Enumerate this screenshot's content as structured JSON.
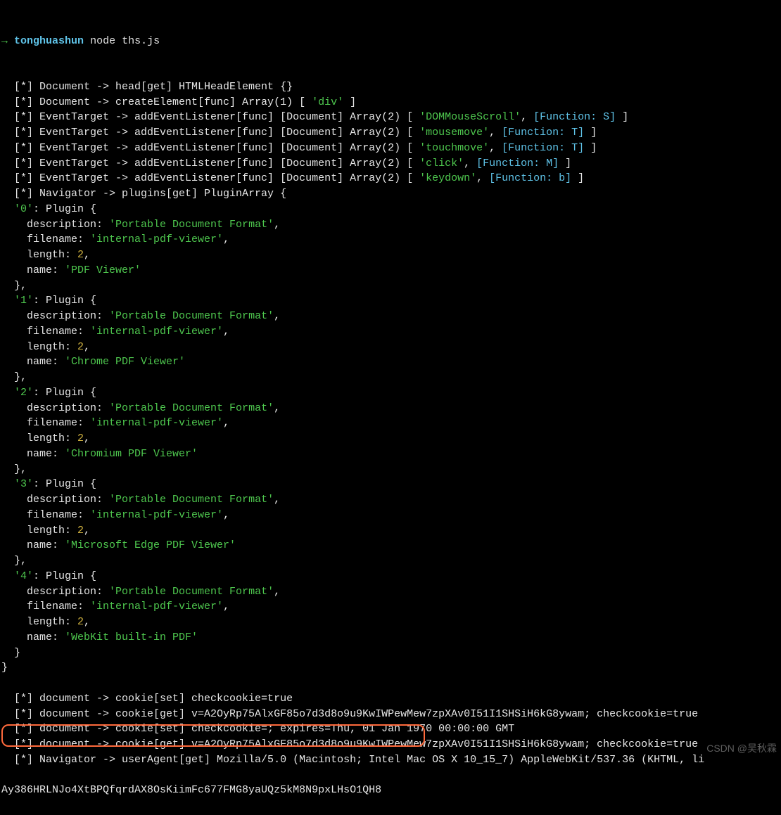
{
  "prompt": {
    "arrow": "→",
    "dir": "tonghuashun",
    "cmd": "node ths.js"
  },
  "lines": [
    [
      {
        "c": "white",
        "t": "  [*] Document -> head[get] HTMLHeadElement {}"
      }
    ],
    [
      {
        "c": "white",
        "t": "  [*] Document -> createElement[func] Array(1) [ "
      },
      {
        "c": "str",
        "t": "'div'"
      },
      {
        "c": "white",
        "t": " ]"
      }
    ],
    [
      {
        "c": "white",
        "t": "  [*] EventTarget -> addEventListener[func] [Document] Array(2) [ "
      },
      {
        "c": "str",
        "t": "'DOMMouseScroll'"
      },
      {
        "c": "white",
        "t": ", "
      },
      {
        "c": "cyan",
        "t": "[Function: S]"
      },
      {
        "c": "white",
        "t": " ]"
      }
    ],
    [
      {
        "c": "white",
        "t": "  [*] EventTarget -> addEventListener[func] [Document] Array(2) [ "
      },
      {
        "c": "str",
        "t": "'mousemove'"
      },
      {
        "c": "white",
        "t": ", "
      },
      {
        "c": "cyan",
        "t": "[Function: T]"
      },
      {
        "c": "white",
        "t": " ]"
      }
    ],
    [
      {
        "c": "white",
        "t": "  [*] EventTarget -> addEventListener[func] [Document] Array(2) [ "
      },
      {
        "c": "str",
        "t": "'touchmove'"
      },
      {
        "c": "white",
        "t": ", "
      },
      {
        "c": "cyan",
        "t": "[Function: T]"
      },
      {
        "c": "white",
        "t": " ]"
      }
    ],
    [
      {
        "c": "white",
        "t": "  [*] EventTarget -> addEventListener[func] [Document] Array(2) [ "
      },
      {
        "c": "str",
        "t": "'click'"
      },
      {
        "c": "white",
        "t": ", "
      },
      {
        "c": "cyan",
        "t": "[Function: M]"
      },
      {
        "c": "white",
        "t": " ]"
      }
    ],
    [
      {
        "c": "white",
        "t": "  [*] EventTarget -> addEventListener[func] [Document] Array(2) [ "
      },
      {
        "c": "str",
        "t": "'keydown'"
      },
      {
        "c": "white",
        "t": ", "
      },
      {
        "c": "cyan",
        "t": "[Function: b]"
      },
      {
        "c": "white",
        "t": " ]"
      }
    ],
    [
      {
        "c": "white",
        "t": "  [*] Navigator -> plugins[get] PluginArray {"
      }
    ],
    [
      {
        "c": "white",
        "t": "  "
      },
      {
        "c": "str",
        "t": "'0'"
      },
      {
        "c": "white",
        "t": ": Plugin {"
      }
    ],
    [
      {
        "c": "white",
        "t": "    description: "
      },
      {
        "c": "str",
        "t": "'Portable Document Format'"
      },
      {
        "c": "white",
        "t": ","
      }
    ],
    [
      {
        "c": "white",
        "t": "    filename: "
      },
      {
        "c": "str",
        "t": "'internal-pdf-viewer'"
      },
      {
        "c": "white",
        "t": ","
      }
    ],
    [
      {
        "c": "white",
        "t": "    length: "
      },
      {
        "c": "num",
        "t": "2"
      },
      {
        "c": "white",
        "t": ","
      }
    ],
    [
      {
        "c": "white",
        "t": "    name: "
      },
      {
        "c": "str",
        "t": "'PDF Viewer'"
      }
    ],
    [
      {
        "c": "white",
        "t": "  },"
      }
    ],
    [
      {
        "c": "white",
        "t": "  "
      },
      {
        "c": "str",
        "t": "'1'"
      },
      {
        "c": "white",
        "t": ": Plugin {"
      }
    ],
    [
      {
        "c": "white",
        "t": "    description: "
      },
      {
        "c": "str",
        "t": "'Portable Document Format'"
      },
      {
        "c": "white",
        "t": ","
      }
    ],
    [
      {
        "c": "white",
        "t": "    filename: "
      },
      {
        "c": "str",
        "t": "'internal-pdf-viewer'"
      },
      {
        "c": "white",
        "t": ","
      }
    ],
    [
      {
        "c": "white",
        "t": "    length: "
      },
      {
        "c": "num",
        "t": "2"
      },
      {
        "c": "white",
        "t": ","
      }
    ],
    [
      {
        "c": "white",
        "t": "    name: "
      },
      {
        "c": "str",
        "t": "'Chrome PDF Viewer'"
      }
    ],
    [
      {
        "c": "white",
        "t": "  },"
      }
    ],
    [
      {
        "c": "white",
        "t": "  "
      },
      {
        "c": "str",
        "t": "'2'"
      },
      {
        "c": "white",
        "t": ": Plugin {"
      }
    ],
    [
      {
        "c": "white",
        "t": "    description: "
      },
      {
        "c": "str",
        "t": "'Portable Document Format'"
      },
      {
        "c": "white",
        "t": ","
      }
    ],
    [
      {
        "c": "white",
        "t": "    filename: "
      },
      {
        "c": "str",
        "t": "'internal-pdf-viewer'"
      },
      {
        "c": "white",
        "t": ","
      }
    ],
    [
      {
        "c": "white",
        "t": "    length: "
      },
      {
        "c": "num",
        "t": "2"
      },
      {
        "c": "white",
        "t": ","
      }
    ],
    [
      {
        "c": "white",
        "t": "    name: "
      },
      {
        "c": "str",
        "t": "'Chromium PDF Viewer'"
      }
    ],
    [
      {
        "c": "white",
        "t": "  },"
      }
    ],
    [
      {
        "c": "white",
        "t": "  "
      },
      {
        "c": "str",
        "t": "'3'"
      },
      {
        "c": "white",
        "t": ": Plugin {"
      }
    ],
    [
      {
        "c": "white",
        "t": "    description: "
      },
      {
        "c": "str",
        "t": "'Portable Document Format'"
      },
      {
        "c": "white",
        "t": ","
      }
    ],
    [
      {
        "c": "white",
        "t": "    filename: "
      },
      {
        "c": "str",
        "t": "'internal-pdf-viewer'"
      },
      {
        "c": "white",
        "t": ","
      }
    ],
    [
      {
        "c": "white",
        "t": "    length: "
      },
      {
        "c": "num",
        "t": "2"
      },
      {
        "c": "white",
        "t": ","
      }
    ],
    [
      {
        "c": "white",
        "t": "    name: "
      },
      {
        "c": "str",
        "t": "'Microsoft Edge PDF Viewer'"
      }
    ],
    [
      {
        "c": "white",
        "t": "  },"
      }
    ],
    [
      {
        "c": "white",
        "t": "  "
      },
      {
        "c": "str",
        "t": "'4'"
      },
      {
        "c": "white",
        "t": ": Plugin {"
      }
    ],
    [
      {
        "c": "white",
        "t": "    description: "
      },
      {
        "c": "str",
        "t": "'Portable Document Format'"
      },
      {
        "c": "white",
        "t": ","
      }
    ],
    [
      {
        "c": "white",
        "t": "    filename: "
      },
      {
        "c": "str",
        "t": "'internal-pdf-viewer'"
      },
      {
        "c": "white",
        "t": ","
      }
    ],
    [
      {
        "c": "white",
        "t": "    length: "
      },
      {
        "c": "num",
        "t": "2"
      },
      {
        "c": "white",
        "t": ","
      }
    ],
    [
      {
        "c": "white",
        "t": "    name: "
      },
      {
        "c": "str",
        "t": "'WebKit built-in PDF'"
      }
    ],
    [
      {
        "c": "white",
        "t": "  }"
      }
    ],
    [
      {
        "c": "white",
        "t": "}"
      }
    ],
    [
      {
        "c": "white",
        "t": ""
      }
    ],
    [
      {
        "c": "white",
        "t": "  [*] document -> cookie[set] checkcookie=true"
      }
    ],
    [
      {
        "c": "white",
        "t": "  [*] document -> cookie[get] v=A2OyRp75AlxGF85o7d3d8o9u9KwIWPewMew7zpXAv0I51I1SHSiH6kG8ywam; checkcookie=true"
      }
    ],
    [
      {
        "c": "white",
        "t": "  [*] document -> cookie[set] checkcookie=; expires=Thu, 01 Jan 1970 00:00:00 GMT"
      }
    ],
    [
      {
        "c": "white",
        "t": "  [*] document -> cookie[get] v=A2OyRp75AlxGF85o7d3d8o9u9KwIWPewMew7zpXAv0I51I1SHSiH6kG8ywam; checkcookie=true"
      }
    ],
    [
      {
        "c": "white",
        "t": "  [*] Navigator -> userAgent[get] Mozilla/5.0 (Macintosh; Intel Mac OS X 10_15_7) AppleWebKit/537.36 (KHTML, li"
      }
    ],
    [
      {
        "c": "white",
        "t": ""
      }
    ],
    [
      {
        "c": "white",
        "t": "Ay386HRLNJo4XtBPQfqrdAX8OsKiimFc677FMG8yaUQz5kM8N9pxLHsO1QH8"
      }
    ]
  ],
  "watermark": "CSDN @吴秋霖"
}
